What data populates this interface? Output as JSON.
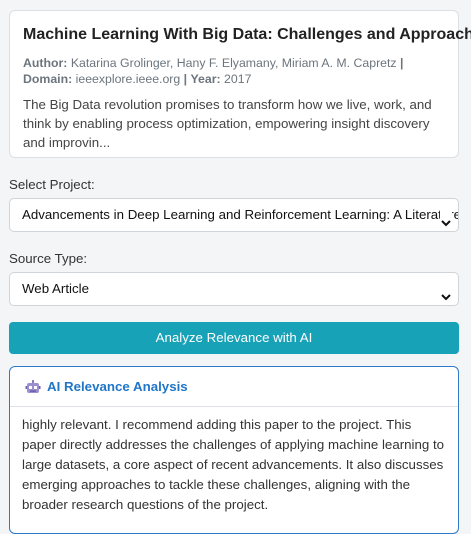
{
  "paper": {
    "title": "Machine Learning With Big Data: Challenges and Approaches",
    "author_label": "Author:",
    "authors": "Katarina Grolinger, Hany F. Elyamany, Miriam A. M. Capretz",
    "domain_label": "Domain:",
    "domain": "ieeexplore.ieee.org",
    "year_label": "Year:",
    "year": "2017",
    "abstract": "The Big Data revolution promises to transform how we live, work, and think by enabling process optimization, empowering insight discovery and improvin..."
  },
  "project": {
    "label": "Select Project:",
    "selected": "Advancements in Deep Learning and Reinforcement Learning: A Literature"
  },
  "source": {
    "label": "Source Type:",
    "selected": "Web Article"
  },
  "analyze_button": "Analyze Relevance with AI",
  "analysis": {
    "icon": "robot-icon",
    "title": "AI Relevance Analysis",
    "text": "highly relevant. I recommend adding this paper to the project. This paper directly addresses the challenges of applying machine learning to large datasets, a core aspect of recent advancements. It also discusses emerging approaches to tackle these challenges, aligning with the broader research questions of the project."
  },
  "colors": {
    "accent": "#17a2b8",
    "analysis_border": "#2e7ac9",
    "analysis_title": "#2176c8"
  }
}
